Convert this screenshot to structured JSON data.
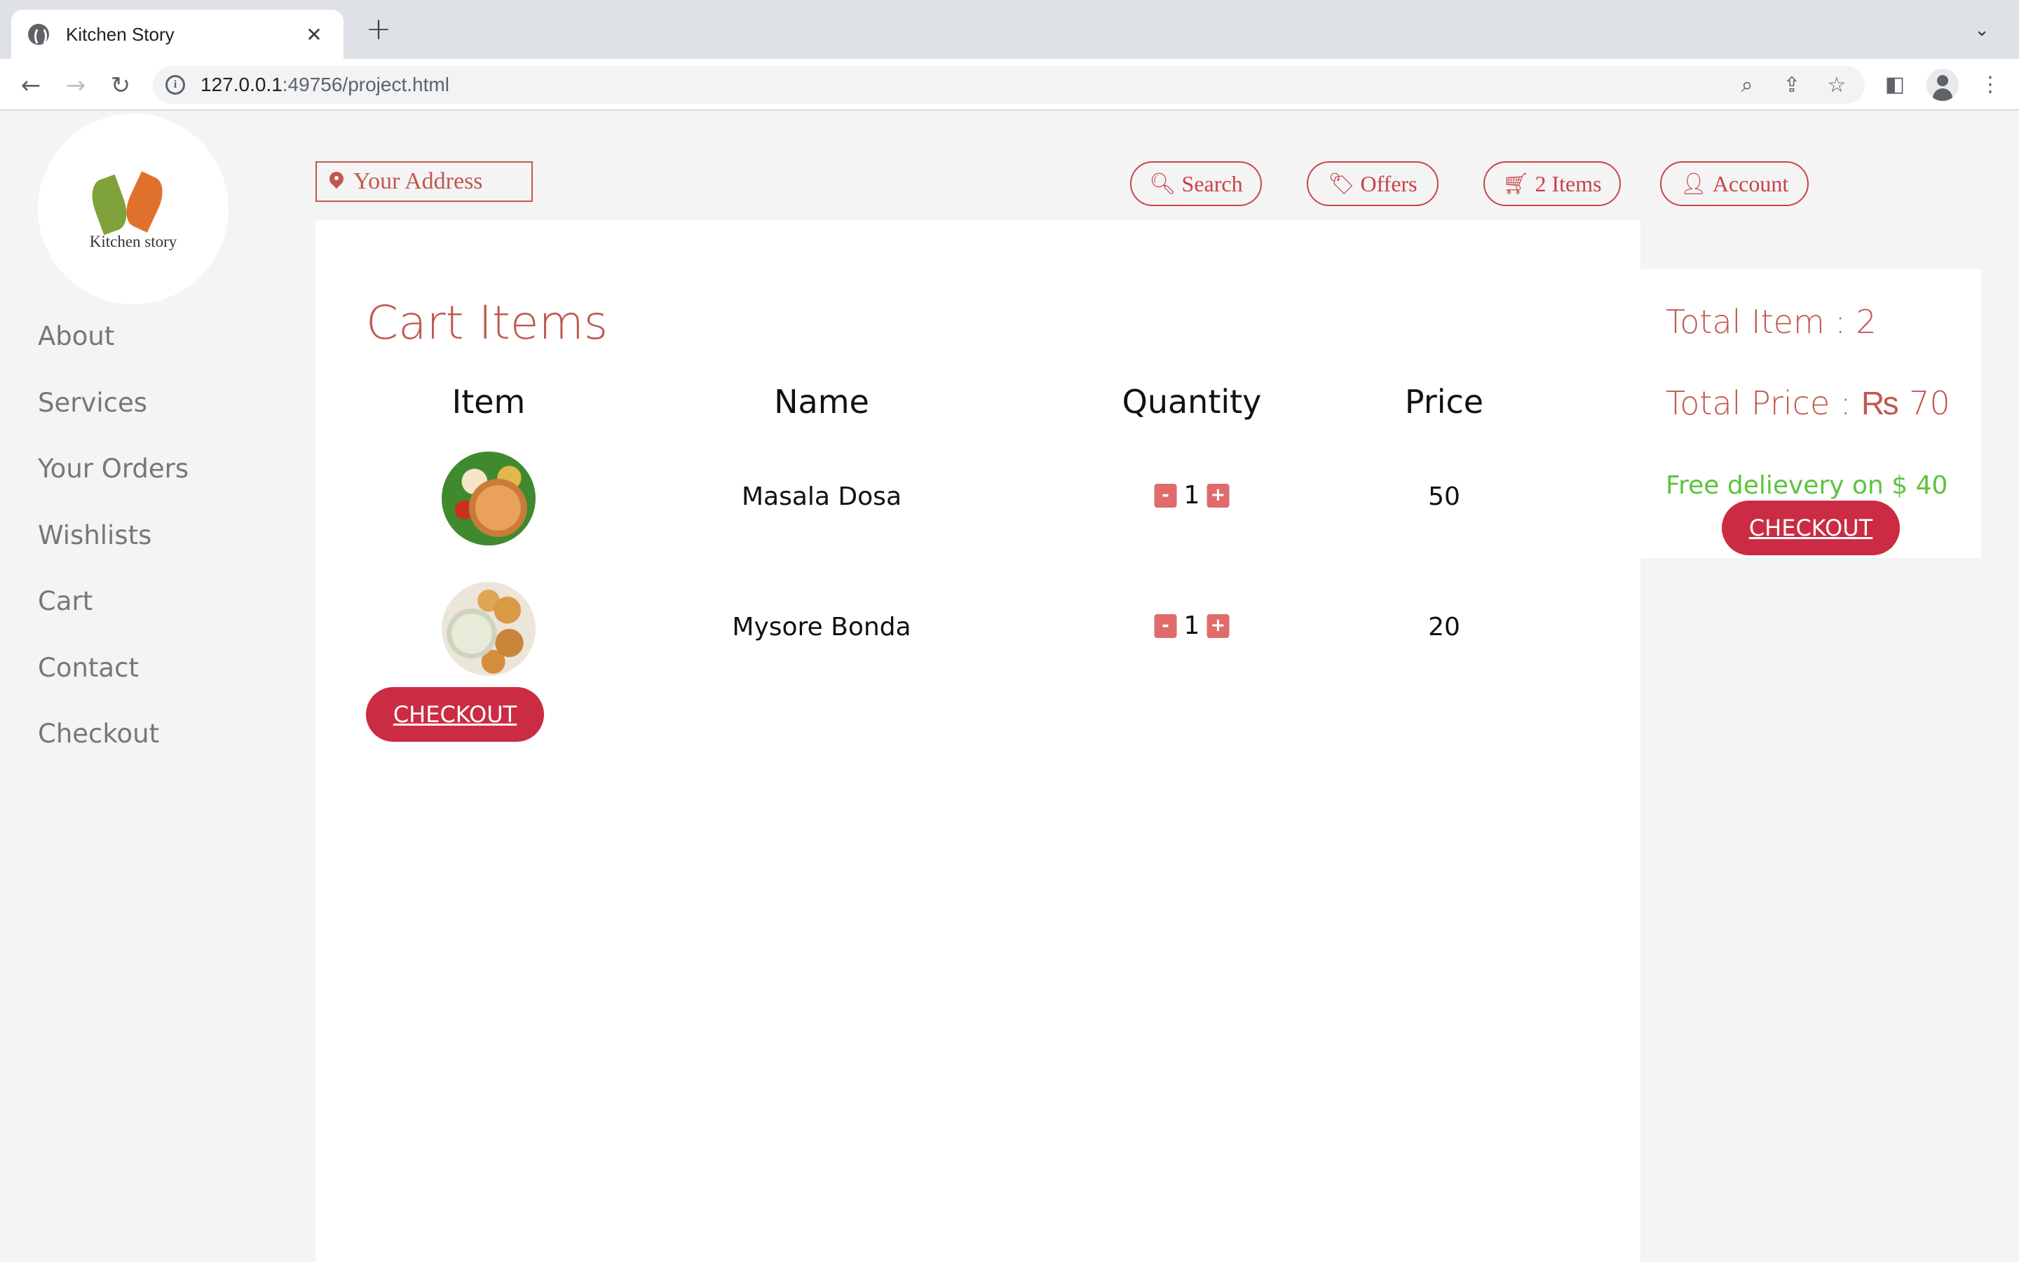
{
  "browser": {
    "tab_title": "Kitchen Story",
    "url_host": "127.0.0.1",
    "url_path": ":49756/project.html"
  },
  "logo": {
    "text": "Kitchen story"
  },
  "sidebar": {
    "items": [
      {
        "label": "About"
      },
      {
        "label": "Services"
      },
      {
        "label": "Your Orders"
      },
      {
        "label": "Wishlists"
      },
      {
        "label": "Cart"
      },
      {
        "label": "Contact"
      },
      {
        "label": "Checkout"
      }
    ]
  },
  "header": {
    "address_placeholder": "Your Address",
    "search_label": "Search",
    "offers_label": "Offers",
    "cart_label": "2 Items",
    "account_label": "Account",
    "accent_color": "#c8434b"
  },
  "cart": {
    "title": "Cart Items",
    "columns": [
      "Item",
      "Name",
      "Quantity",
      "Price"
    ],
    "rows": [
      {
        "image": "masala-dosa-photo",
        "name": "Masala Dosa",
        "quantity": "1",
        "price": "50"
      },
      {
        "image": "mysore-bonda-photo",
        "name": "Mysore Bonda",
        "quantity": "1",
        "price": "20"
      }
    ],
    "minus_label": "-",
    "plus_label": "+",
    "checkout_label": "CHECKOUT"
  },
  "summary": {
    "total_items": "Total Item : 2",
    "total_price": "Total Price : ₨ 70",
    "free_delivery": "Free delievery on $ 40",
    "checkout_label": "CHECKOUT"
  }
}
